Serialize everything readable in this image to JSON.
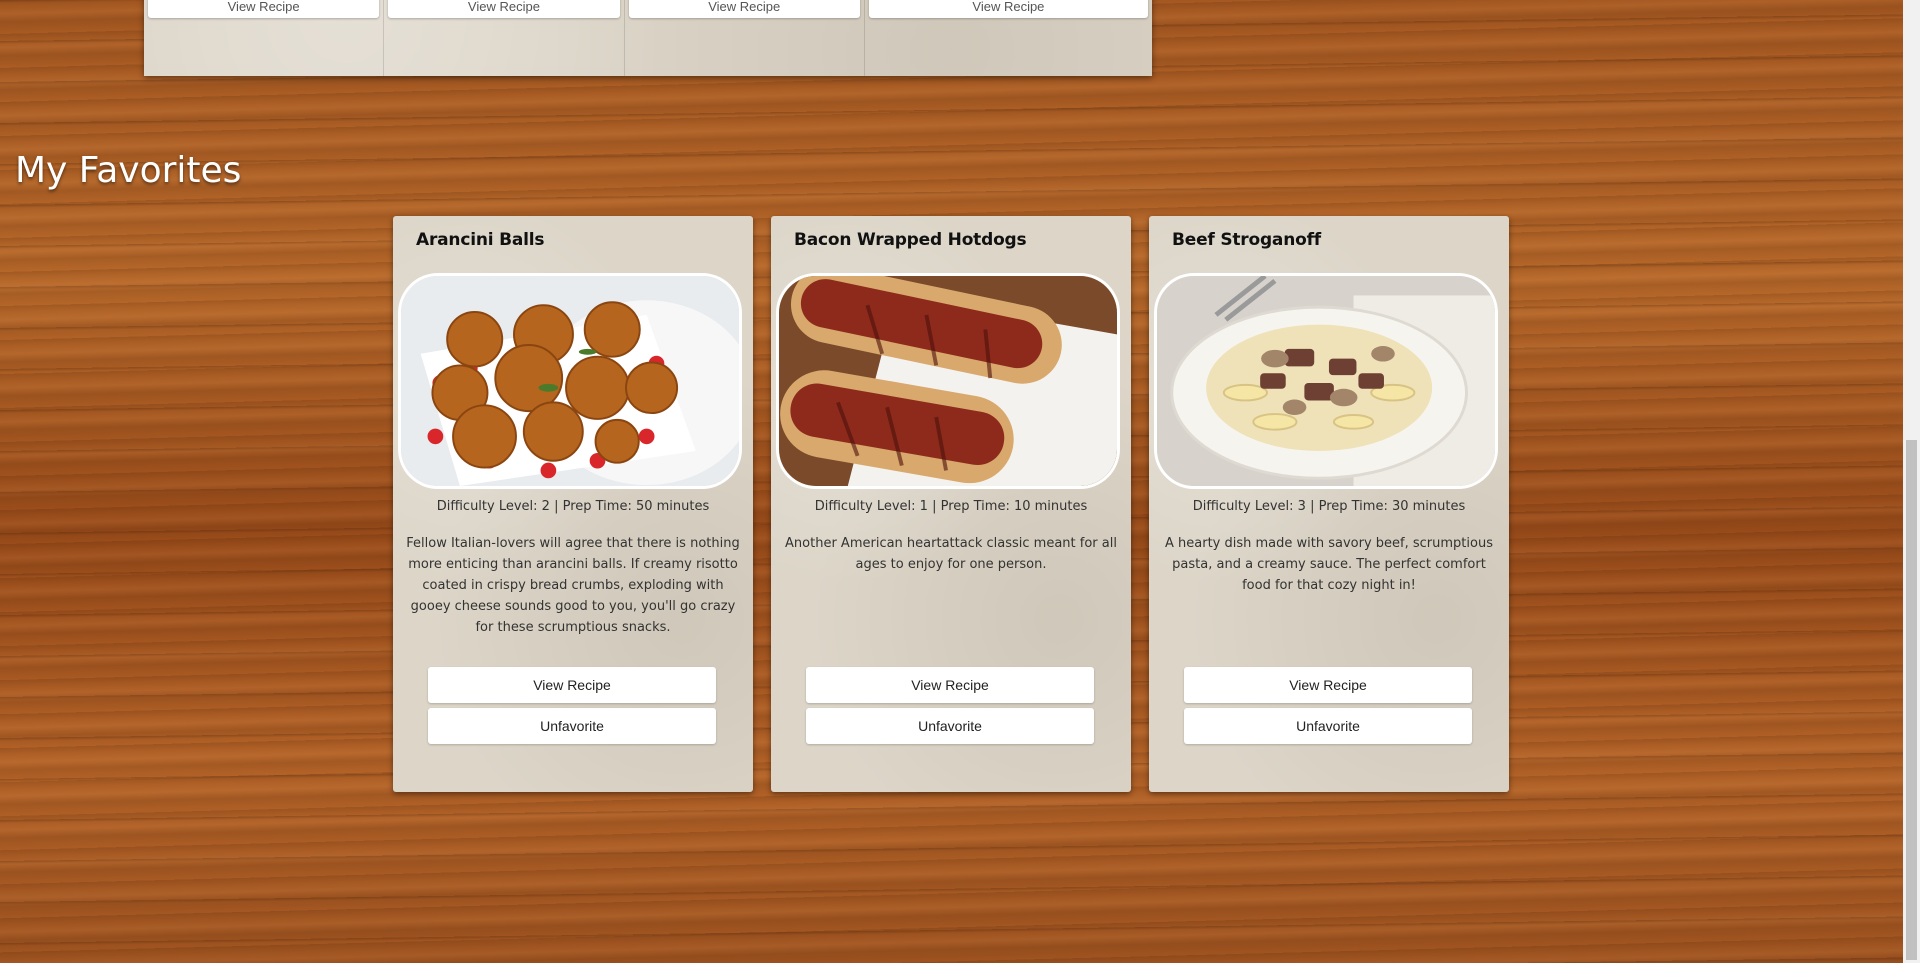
{
  "previous_section": {
    "cards": [
      {
        "button_label": "View Recipe"
      },
      {
        "button_label": "View Recipe"
      },
      {
        "button_label": "View Recipe"
      },
      {
        "button_label": "View Recipe"
      }
    ]
  },
  "favorites": {
    "heading": "My Favorites",
    "cards": [
      {
        "title": "Arancini Balls",
        "image": "arancini-balls-photo",
        "meta": "Difficulty Level: 2 | Prep Time: 50 minutes",
        "description": "Fellow Italian-lovers will agree that there is nothing more enticing than arancini balls. If creamy risotto coated in crispy bread crumbs, exploding with gooey cheese sounds good to you, you'll go crazy for these scrumptious snacks.",
        "view_label": "View Recipe",
        "unfavorite_label": "Unfavorite"
      },
      {
        "title": "Bacon Wrapped Hotdogs",
        "image": "bacon-wrapped-hotdogs-photo",
        "meta": "Difficulty Level: 1 | Prep Time: 10 minutes",
        "description": "Another American heartattack classic meant for all ages to enjoy for one person.",
        "view_label": "View Recipe",
        "unfavorite_label": "Unfavorite"
      },
      {
        "title": "Beef Stroganoff",
        "image": "beef-stroganoff-photo",
        "meta": "Difficulty Level: 3 | Prep Time: 30 minutes",
        "description": "A hearty dish made with savory beef, scrumptious pasta, and a creamy sauce. The perfect comfort food for that cozy night in!",
        "view_label": "View Recipe",
        "unfavorite_label": "Unfavorite"
      }
    ]
  }
}
